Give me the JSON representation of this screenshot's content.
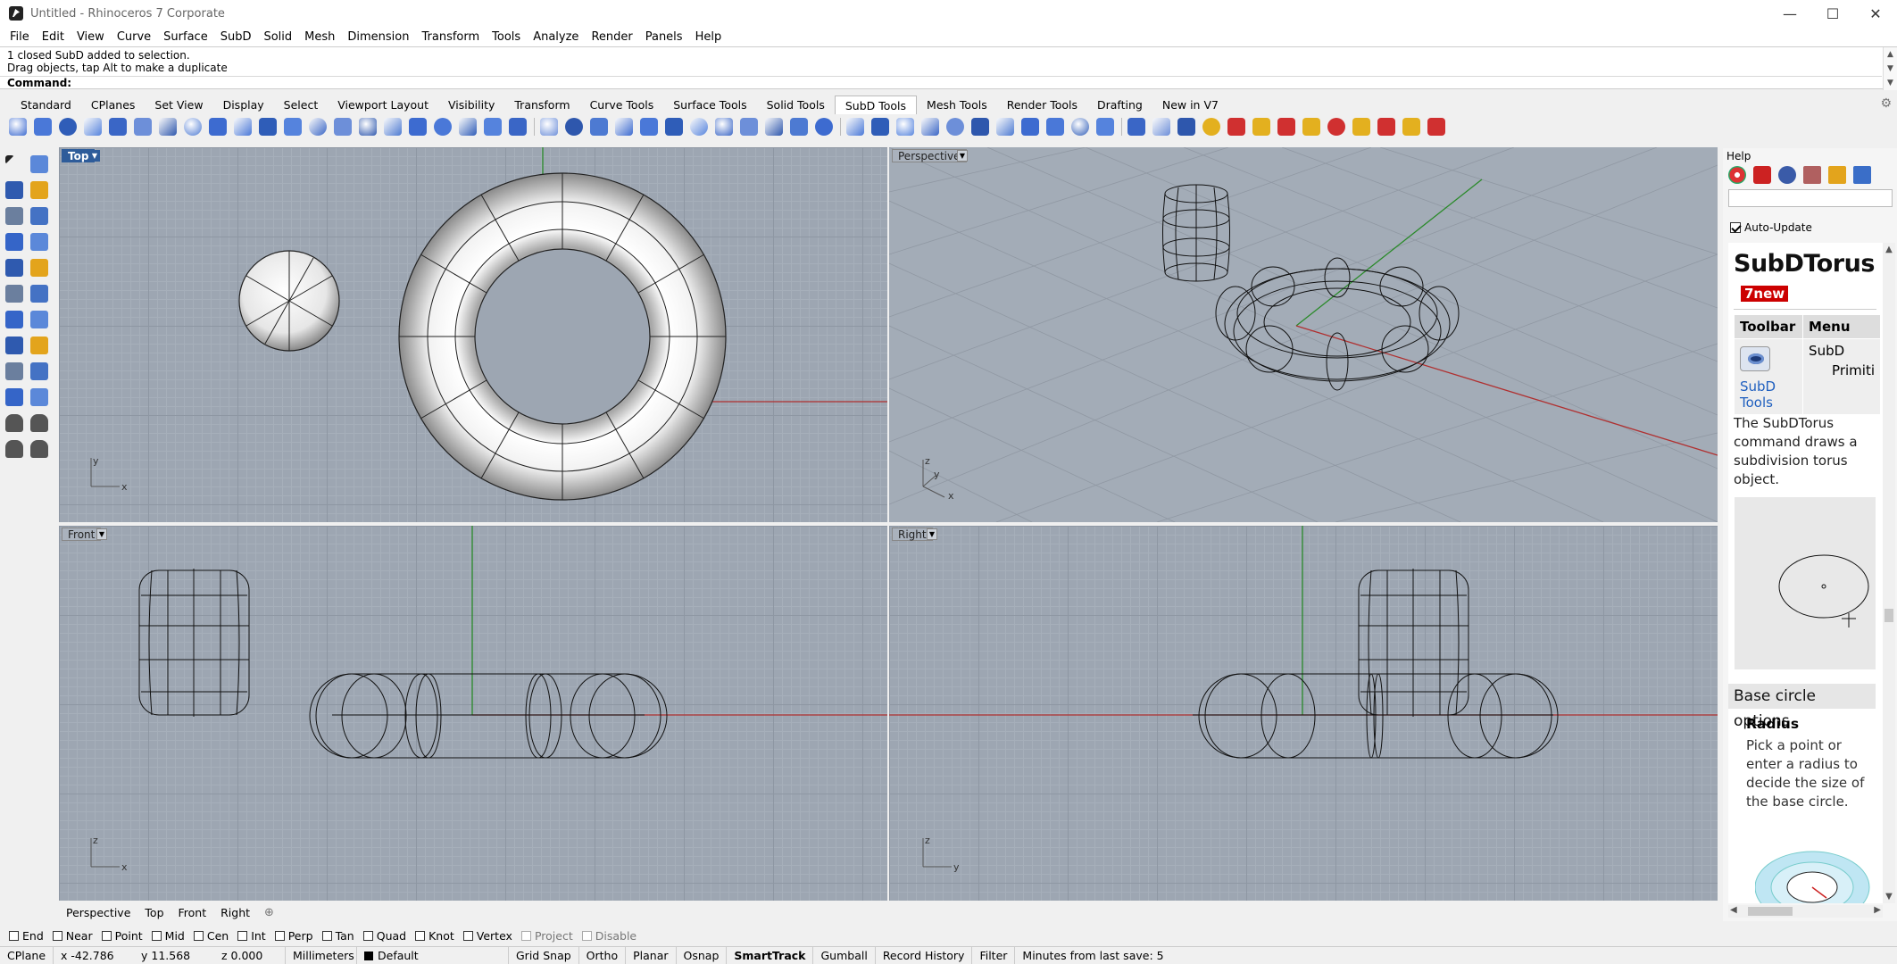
{
  "window": {
    "title": "Untitled - Rhinoceros 7 Corporate",
    "min": "—",
    "max": "☐",
    "close": "✕"
  },
  "menu": [
    "File",
    "Edit",
    "View",
    "Curve",
    "Surface",
    "SubD",
    "Solid",
    "Mesh",
    "Dimension",
    "Transform",
    "Tools",
    "Analyze",
    "Render",
    "Panels",
    "Help"
  ],
  "command": {
    "history_1": "1 closed SubD added to selection.",
    "history_2": "Drag objects, tap Alt to make a duplicate",
    "prompt": "Command:"
  },
  "toolbar_tabs": [
    "Standard",
    "CPlanes",
    "Set View",
    "Display",
    "Select",
    "Viewport Layout",
    "Visibility",
    "Transform",
    "Curve Tools",
    "Surface Tools",
    "Solid Tools",
    "SubD Tools",
    "Mesh Tools",
    "Render Tools",
    "Drafting",
    "New in V7"
  ],
  "active_tab": "SubD Tools",
  "viewports": {
    "top": {
      "label": "Top",
      "x_axis": "x",
      "y_axis": "y"
    },
    "perspective": {
      "label": "Perspective",
      "x_axis": "x",
      "y_axis": "y",
      "z_axis": "z"
    },
    "front": {
      "label": "Front",
      "x_axis": "x",
      "z_axis": "z"
    },
    "right": {
      "label": "Right",
      "y_axis": "y",
      "z_axis": "z"
    }
  },
  "viewport_tabs": [
    "Perspective",
    "Top",
    "Front",
    "Right"
  ],
  "osnaps": [
    {
      "label": "End",
      "enabled": true
    },
    {
      "label": "Near",
      "enabled": true
    },
    {
      "label": "Point",
      "enabled": true
    },
    {
      "label": "Mid",
      "enabled": true
    },
    {
      "label": "Cen",
      "enabled": true
    },
    {
      "label": "Int",
      "enabled": true
    },
    {
      "label": "Perp",
      "enabled": true
    },
    {
      "label": "Tan",
      "enabled": true
    },
    {
      "label": "Quad",
      "enabled": true
    },
    {
      "label": "Knot",
      "enabled": true
    },
    {
      "label": "Vertex",
      "enabled": true
    },
    {
      "label": "Project",
      "enabled": false
    },
    {
      "label": "Disable",
      "enabled": false
    }
  ],
  "status": {
    "cplane": "CPlane",
    "x": "x -42.786",
    "y": "y 11.568",
    "z": "z 0.000",
    "units": "Millimeters",
    "layer": "Default",
    "grid_snap": "Grid Snap",
    "ortho": "Ortho",
    "planar": "Planar",
    "osnap": "Osnap",
    "smarttrack": "SmartTrack",
    "gumball": "Gumball",
    "record_history": "Record History",
    "filter": "Filter",
    "save_info": "Minutes from last save: 5"
  },
  "help_panel": {
    "title": "Help",
    "auto_update": "Auto-Update",
    "heading": "SubDTorus",
    "badge": "7new",
    "col_toolbar": "Toolbar",
    "col_menu": "Menu",
    "toolbar_link": "SubD Tools",
    "menu_path_1": "SubD",
    "menu_path_2": "Primiti",
    "description": "The SubDTorus command draws a subdivision torus object.",
    "section": "Base circle options",
    "option_name": "Radius",
    "option_desc": "Pick a point or enter a radius to decide the size of the base circle."
  },
  "colors": {
    "viewport_bg": "#9da6b2",
    "active_label": "#2e5c9a",
    "x_axis": "#b03030",
    "y_axis": "#2a8a2a",
    "badge": "#cc0000"
  },
  "icons": [
    "subd-tools-icons"
  ]
}
